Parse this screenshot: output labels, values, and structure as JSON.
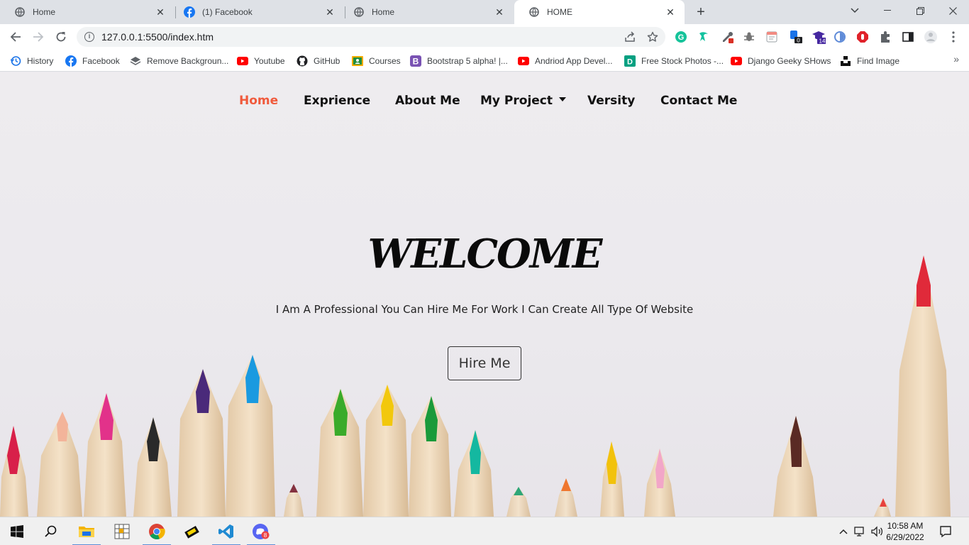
{
  "browser": {
    "tabs": [
      {
        "title": "Home",
        "icon": "globe-icon"
      },
      {
        "title": "(1) Facebook",
        "icon": "facebook-icon"
      },
      {
        "title": "Home",
        "icon": "globe-icon"
      },
      {
        "title": "HOME",
        "icon": "globe-icon",
        "active": true
      }
    ],
    "url": "127.0.0.1:5500/index.htm",
    "extensions": [
      "grammarly-icon",
      "tampermonkey-icon",
      "color-picker-icon",
      "bug-icon",
      "notes-icon",
      "extension-badge-icon",
      "graduation-cap-icon",
      "circle-extension-icon",
      "adblock-icon",
      "puzzle-icon",
      "sidebar-icon",
      "profile-icon",
      "more-vertical-icon"
    ],
    "extension_badges": {
      "badge_a": "0",
      "badge_b": "14"
    }
  },
  "bookmarks": [
    {
      "label": "History",
      "icon": "history-icon"
    },
    {
      "label": "Facebook",
      "icon": "facebook-icon"
    },
    {
      "label": "Remove Backgroun...",
      "icon": "layers-icon"
    },
    {
      "label": "Youtube",
      "icon": "youtube-icon"
    },
    {
      "label": "GitHub",
      "icon": "github-icon"
    },
    {
      "label": "Courses",
      "icon": "classroom-icon"
    },
    {
      "label": "Bootstrap 5 alpha! |...",
      "icon": "bootstrap-icon"
    },
    {
      "label": "Andriod App Devel...",
      "icon": "youtube-icon"
    },
    {
      "label": "Free Stock Photos -...",
      "icon": "d-icon"
    },
    {
      "label": "Django Geeky SHows",
      "icon": "youtube-icon"
    },
    {
      "label": "Find Image",
      "icon": "unsplash-icon"
    }
  ],
  "site": {
    "nav": [
      {
        "label": "Home",
        "active": true
      },
      {
        "label": "Exprience"
      },
      {
        "label": "About Me"
      },
      {
        "label": "My Project",
        "dropdown": true
      },
      {
        "label": "Versity"
      },
      {
        "label": "Contact Me"
      }
    ],
    "hero": {
      "title": "WELCOME",
      "subtitle": "I Am A Professional You Can Hire Me For Work I Can Create All Type Of Website",
      "button": "Hire Me"
    },
    "colors": {
      "accent": "#f05a3c",
      "text": "#111111"
    }
  },
  "taskbar": {
    "apps": [
      "windows-start-icon",
      "search-icon",
      "file-explorer-icon",
      "grid-app-icon",
      "chrome-icon",
      "chip-app-icon",
      "vscode-icon",
      "discord-icon"
    ],
    "discord_badge": "8",
    "time": "10:58 AM",
    "date": "6/29/2022"
  }
}
